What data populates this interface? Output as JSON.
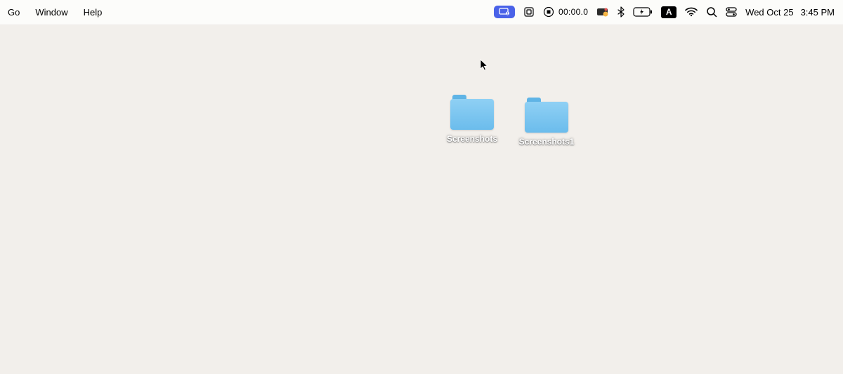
{
  "menubar": {
    "items": [
      "Go",
      "Window",
      "Help"
    ]
  },
  "status": {
    "video_indicator": "video",
    "picture_in_picture": "pip",
    "timer": "00:00.0",
    "input_source": "A",
    "date": "Wed Oct 25",
    "time": "3:45 PM"
  },
  "desktop": {
    "folders": [
      {
        "name": "Screenshots"
      },
      {
        "name": "Screenshots1"
      }
    ]
  }
}
